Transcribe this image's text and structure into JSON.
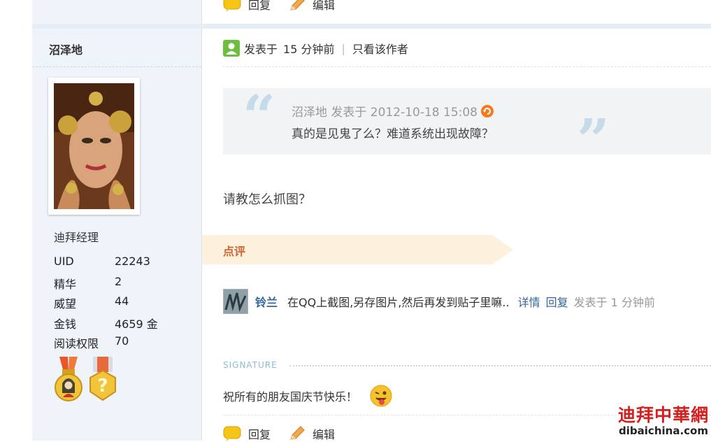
{
  "top_actions": {
    "reply_label": "回复",
    "edit_label": "编辑"
  },
  "author": {
    "name": "沼泽地",
    "rank": "迪拜经理",
    "stats": [
      {
        "label": "UID",
        "value": "22243"
      },
      {
        "label": "精华",
        "value": "2"
      },
      {
        "label": "威望",
        "value": "44"
      },
      {
        "label": "金钱",
        "value": "4659 金"
      },
      {
        "label": "阅读权限",
        "value": "70"
      }
    ],
    "medals": [
      "female-avatar-medal-icon",
      "question-medal-icon"
    ]
  },
  "post": {
    "posted_prefix": "发表于",
    "posted_time": "15 分钟前",
    "only_author_label": "只看该作者",
    "quote": {
      "header": "沼泽地 发表于 2012-10-18 15:08",
      "text": "真的是见鬼了么？难道系统出现故障？"
    },
    "body": "请教怎么抓图？"
  },
  "review": {
    "label": "点评",
    "comment": {
      "user": "铃兰",
      "text": "在QQ上截图,另存图片,然后再发到贴子里嘛..",
      "detail_link": "详情",
      "reply_link": "回复",
      "time": "发表于 1 分钟前"
    }
  },
  "signature": {
    "label": "SIGNATURE",
    "text": "祝所有的朋友国庆节快乐！"
  },
  "bottom_actions": {
    "reply_label": "回复",
    "edit_label": "编辑"
  },
  "watermark": {
    "cn": "迪拜中華網",
    "en": "dibaichina.com"
  },
  "colors": {
    "sidebar_bg": "#eef4fa",
    "link": "#336699",
    "review_banner": "#fdf0dc",
    "review_label": "#cc6633"
  }
}
